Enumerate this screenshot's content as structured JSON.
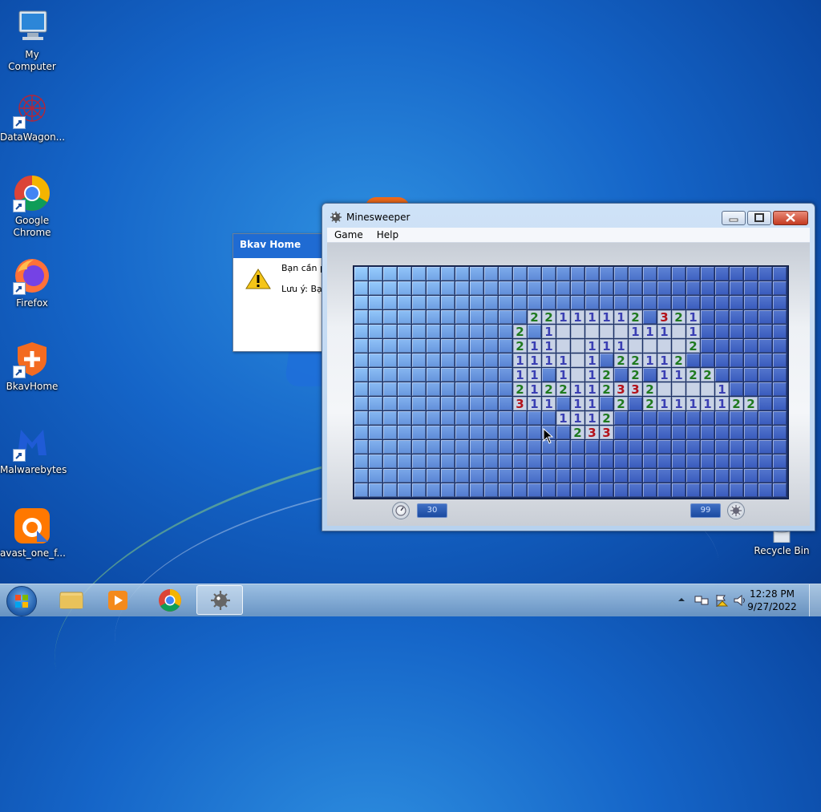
{
  "desktop": {
    "icons": [
      {
        "label": "My Computer",
        "icon": "computer-icon"
      },
      {
        "label": "DataWagon...",
        "icon": "datawagon-icon"
      },
      {
        "label": "Google Chrome",
        "icon": "chrome-icon"
      },
      {
        "label": "Firefox",
        "icon": "firefox-icon"
      },
      {
        "label": "BkavHome",
        "icon": "bkav-icon"
      },
      {
        "label": "Malwarebytes",
        "icon": "malwarebytes-icon"
      },
      {
        "label": "avast_one_f...",
        "icon": "avast-icon"
      },
      {
        "label": "Recycle Bin",
        "icon": "recycle-bin-icon"
      }
    ]
  },
  "bkav_dialog": {
    "title": "Bkav Home",
    "line1": "Bạn cần ph",
    "line2": "Lưu ý: Bạn"
  },
  "minesweeper": {
    "title": "Minesweeper",
    "menu": [
      "Game",
      "Help"
    ],
    "time": "30",
    "mines": "99",
    "board": {
      "cols": 30,
      "rows": 16,
      "rows_data": [
        "CCCCCCCCCCCCCCCCCCCCCCCCCCCCCC",
        "CCCCCCCCCCCCCCCCCCCCCCCCCCCCCC",
        "CCCCCCCCCCCCCCCCCCCCCCCCCCCCCC",
        "CCCCCCCCCCCC22111112C321CCCCCC",
        "CCCCCCCCCCC2C1OOOOO111O1CCCCCC",
        "CCCCCCCCCCC211OO111OOOO2CCCCCC",
        "CCCCCCCCCCC1111O1C22112CCCCCCC",
        "CCCCCCCCCCC11C1O12C2C1122CCCCC",
        "CCCCCCCCCCC2122112332OOOO1CCCC",
        "CCCCCCCCCCC311C11C2C21111122CCC",
        "CCCCCCCCCCCCCC1112CCCCCCCCCCCC",
        "CCCCCCCCCCCCCCC233CCCCCCCCCCCC",
        "CCCCCCCCCCCCCCCCCCCCCCCCCCCCCC",
        "CCCCCCCCCCCCCCCCCCCCCCCCCCCCCC",
        "CCCCCCCCCCCCCCCCCCCCCCCCCCCCCC",
        "CCCCCCCCCCCCCCCCCCCCCCCCCCCCCC"
      ]
    },
    "colors": {
      "1": "#3a3fb3",
      "2": "#1f7a1f",
      "3": "#b3121a"
    }
  },
  "taskbar": {
    "pinned": [
      "windows-explorer-icon",
      "media-player-icon",
      "chrome-icon",
      "minesweeper-icon"
    ],
    "time": "12:28 PM",
    "date": "9/27/2022"
  }
}
